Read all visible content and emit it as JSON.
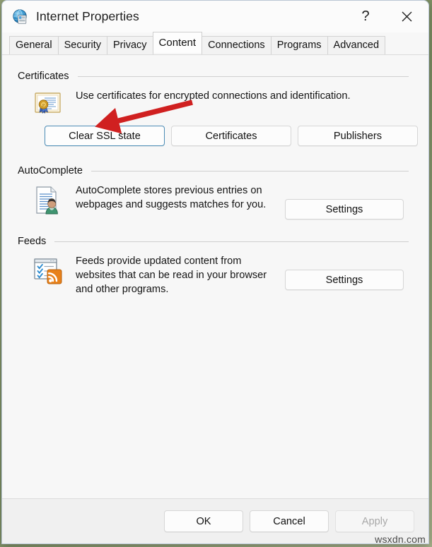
{
  "window": {
    "title": "Internet Properties",
    "icon": "internet-properties-globe-icon",
    "help_label": "?",
    "close_label": "✕"
  },
  "tabs": [
    {
      "label": "General",
      "active": false
    },
    {
      "label": "Security",
      "active": false
    },
    {
      "label": "Privacy",
      "active": false
    },
    {
      "label": "Content",
      "active": true
    },
    {
      "label": "Connections",
      "active": false
    },
    {
      "label": "Programs",
      "active": false
    },
    {
      "label": "Advanced",
      "active": false
    }
  ],
  "groups": {
    "certificates": {
      "label": "Certificates",
      "icon": "certificate-seal-icon",
      "description": "Use certificates for encrypted connections and identification.",
      "buttons": [
        {
          "label": "Clear SSL state",
          "focused": true,
          "disabled": false
        },
        {
          "label": "Certificates",
          "focused": false,
          "disabled": false
        },
        {
          "label": "Publishers",
          "focused": false,
          "disabled": false
        }
      ]
    },
    "autocomplete": {
      "label": "AutoComplete",
      "icon": "autocomplete-person-document-icon",
      "description": "AutoComplete stores previous entries on webpages and suggests matches for you.",
      "settings_label": "Settings"
    },
    "feeds": {
      "label": "Feeds",
      "icon": "feeds-rss-icon",
      "description": "Feeds provide updated content from websites that can be read in your browser and other programs.",
      "settings_label": "Settings"
    }
  },
  "footer": {
    "ok_label": "OK",
    "cancel_label": "Cancel",
    "apply_label": "Apply",
    "apply_disabled": true
  },
  "annotation": {
    "type": "red-arrow",
    "color": "#d02020",
    "points_to": "Clear SSL state"
  },
  "watermark": {
    "text": "wsxdn.com"
  }
}
